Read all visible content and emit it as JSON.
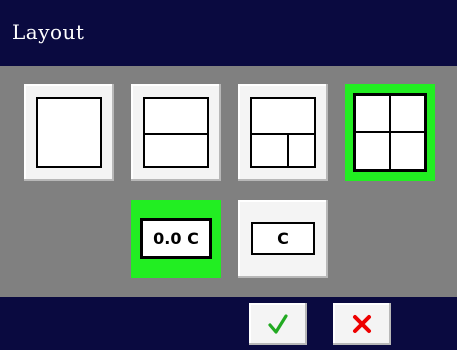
{
  "dialog": {
    "title": "Layout"
  },
  "layouts": [
    {
      "id": "single",
      "selected": false
    },
    {
      "id": "two-horizontal",
      "selected": false
    },
    {
      "id": "three-split",
      "selected": false
    },
    {
      "id": "quad",
      "selected": true
    }
  ],
  "units": [
    {
      "label": "0.0 C",
      "selected": true
    },
    {
      "label": "C",
      "selected": false
    }
  ],
  "actions": {
    "confirm_icon": "checkmark-icon",
    "cancel_icon": "x-icon"
  },
  "colors": {
    "title_bar": "#0a0a40",
    "background": "#808080",
    "selected": "#22ee22",
    "confirm": "#22aa22",
    "cancel": "#ee0000"
  }
}
